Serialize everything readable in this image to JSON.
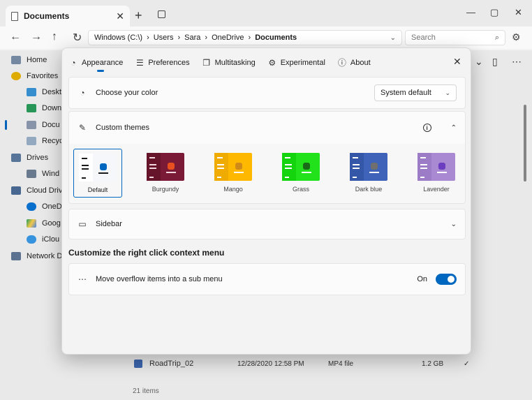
{
  "window": {
    "tab_title": "Documents",
    "breadcrumb": [
      "Windows (C:\\)",
      "Users",
      "Sara",
      "OneDrive",
      "Documents"
    ],
    "search_placeholder": "Search"
  },
  "sidebar": {
    "items": [
      {
        "label": "Home"
      },
      {
        "label": "Favorites"
      },
      {
        "label": "Deskt"
      },
      {
        "label": "Down"
      },
      {
        "label": "Docu"
      },
      {
        "label": "Recyc"
      },
      {
        "label": "Drives"
      },
      {
        "label": "Wind"
      },
      {
        "label": "Cloud Driv"
      },
      {
        "label": "OneD"
      },
      {
        "label": "Goog"
      },
      {
        "label": "iClou"
      },
      {
        "label": "Network D"
      }
    ]
  },
  "files": {
    "row": {
      "name": "RoadTrip_02",
      "date": "12/28/2020 12:58 PM",
      "type": "MP4 file",
      "size": "1.2 GB"
    },
    "status": "21 items"
  },
  "dialog": {
    "tabs": [
      {
        "label": "Appearance",
        "icon": "palette-icon"
      },
      {
        "label": "Preferences",
        "icon": "sliders-icon"
      },
      {
        "label": "Multitasking",
        "icon": "windows-icon"
      },
      {
        "label": "Experimental",
        "icon": "flask-icon"
      },
      {
        "label": "About",
        "icon": "info-icon"
      }
    ],
    "choose_color": {
      "label": "Choose your color",
      "value": "System default"
    },
    "custom_themes": {
      "label": "Custom themes"
    },
    "themes": [
      {
        "name": "Default",
        "bg": "#f5f7fb",
        "side": "#ffffff",
        "accent": "#0067c0",
        "line": "#1b1b1b"
      },
      {
        "name": "Burgundy",
        "bg": "#7a1a36",
        "side": "#651429",
        "accent": "#e8501f",
        "line": "#f2d8de"
      },
      {
        "name": "Mango",
        "bg": "#ffb800",
        "side": "#f0ab00",
        "accent": "#d08a17",
        "line": "#ffffff"
      },
      {
        "name": "Grass",
        "bg": "#22e31b",
        "side": "#14d40e",
        "accent": "#1a6b17",
        "line": "#ffffff"
      },
      {
        "name": "Dark blue",
        "bg": "#3f63b8",
        "side": "#3557a8",
        "accent": "#6f6f6f",
        "line": "#ffffff"
      },
      {
        "name": "Lavender",
        "bg": "#a98ad2",
        "side": "#9c7cc6",
        "accent": "#6c3dc0",
        "line": "#ffffff"
      }
    ],
    "sidebar_section": {
      "label": "Sidebar"
    },
    "context_menu": {
      "title": "Customize the right click context menu",
      "overflow_label": "Move overflow items into a sub menu",
      "state": "On"
    }
  }
}
